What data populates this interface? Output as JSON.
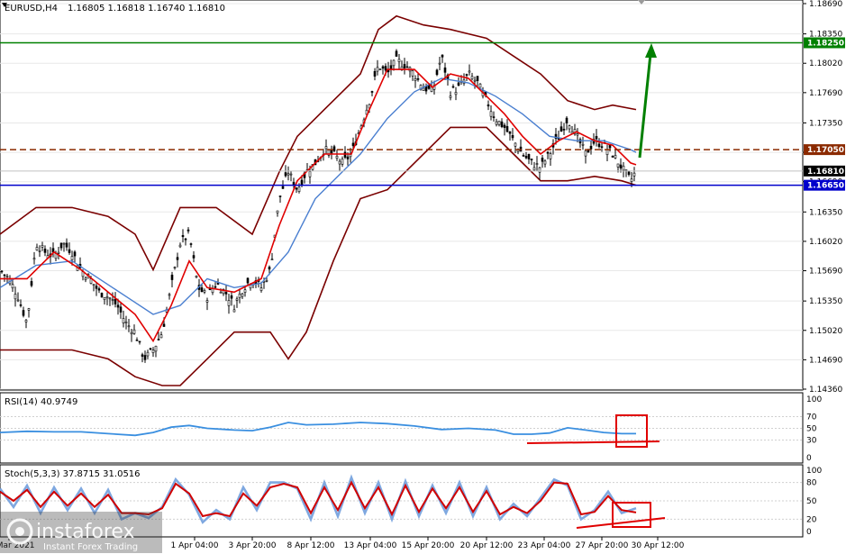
{
  "main_header": {
    "symbol": "EURUSD,H4",
    "values": "1.16805 1.16818 1.16740 1.16810"
  },
  "rsi_header": {
    "label": "RSI(14) 40.9749"
  },
  "stoch_header": {
    "label": "Stoch(5,3,3) 37.8715 31.0516"
  },
  "price_axis": {
    "ticks": [
      "1.18690",
      "1.18350",
      "1.18020",
      "1.17690",
      "1.17350",
      "1.17020",
      "1.16690",
      "1.16350",
      "1.16020",
      "1.15690",
      "1.15350",
      "1.15020",
      "1.14690",
      "1.14360"
    ],
    "levels": [
      {
        "name": "resistance",
        "value": 1.1825,
        "label": "1.18250",
        "color": "#008000",
        "style": "solid"
      },
      {
        "name": "pivot",
        "value": 1.1705,
        "label": "1.17050",
        "color": "#8b2a00",
        "style": "dashed"
      },
      {
        "name": "current",
        "value": 1.1681,
        "label": "1.16810",
        "color": "#c0c0c0",
        "style": "solid"
      },
      {
        "name": "support",
        "value": 1.1665,
        "label": "1.16650",
        "color": "#0000cc",
        "style": "solid"
      }
    ]
  },
  "rsi_axis": {
    "ticks": [
      "100",
      "70",
      "50",
      "30",
      "0"
    ]
  },
  "stoch_axis": {
    "ticks": [
      "100",
      "80",
      "50",
      "20",
      "0"
    ]
  },
  "time_axis": {
    "labels": [
      "29 Mar 2021",
      "1 Apr 04:00",
      "3 Apr 20:00",
      "8 Apr 12:00",
      "13 Apr 04:00",
      "15 Apr 20:00",
      "20 Apr 12:00",
      "23 Apr 04:00",
      "27 Apr 20:00",
      "30 Apr 12:00"
    ]
  },
  "annotations": {
    "arrow_color": "#008000",
    "divergence_color": "#e00000",
    "box_color": "#e00000"
  },
  "watermark": {
    "brand": "instaforex",
    "tagline": "Instant Forex Trading"
  },
  "chart_data": {
    "type": "candlestick",
    "symbol": "EURUSD",
    "timeframe": "H4",
    "ylim": [
      1.1436,
      1.1869
    ],
    "indicators": [
      "Bollinger Bands",
      "Moving Averages",
      "RSI(14)",
      "Stoch(5,3,3)"
    ],
    "close_path": [
      [
        0,
        1.157
      ],
      [
        10,
        1.156
      ],
      [
        20,
        1.154
      ],
      [
        30,
        1.151
      ],
      [
        40,
        1.16
      ],
      [
        50,
        1.159
      ],
      [
        60,
        1.1585
      ],
      [
        70,
        1.16
      ],
      [
        80,
        1.159
      ],
      [
        90,
        1.157
      ],
      [
        100,
        1.156
      ],
      [
        110,
        1.1545
      ],
      [
        120,
        1.154
      ],
      [
        130,
        1.153
      ],
      [
        140,
        1.151
      ],
      [
        150,
        1.15
      ],
      [
        160,
        1.147
      ],
      [
        170,
        1.148
      ],
      [
        180,
        1.15
      ],
      [
        190,
        1.155
      ],
      [
        200,
        1.16
      ],
      [
        210,
        1.161
      ],
      [
        220,
        1.155
      ],
      [
        230,
        1.154
      ],
      [
        240,
        1.1555
      ],
      [
        250,
        1.1545
      ],
      [
        260,
        1.153
      ],
      [
        270,
        1.155
      ],
      [
        280,
        1.156
      ],
      [
        290,
        1.155
      ],
      [
        300,
        1.157
      ],
      [
        310,
        1.165
      ],
      [
        320,
        1.168
      ],
      [
        330,
        1.166
      ],
      [
        340,
        1.168
      ],
      [
        350,
        1.169
      ],
      [
        360,
        1.1705
      ],
      [
        370,
        1.17
      ],
      [
        380,
        1.169
      ],
      [
        390,
        1.17
      ],
      [
        400,
        1.173
      ],
      [
        410,
        1.176
      ],
      [
        420,
        1.18
      ],
      [
        430,
        1.179
      ],
      [
        440,
        1.1805
      ],
      [
        450,
        1.18
      ],
      [
        460,
        1.179
      ],
      [
        470,
        1.1775
      ],
      [
        480,
        1.177
      ],
      [
        490,
        1.181
      ],
      [
        500,
        1.177
      ],
      [
        510,
        1.1775
      ],
      [
        520,
        1.179
      ],
      [
        530,
        1.178
      ],
      [
        540,
        1.176
      ],
      [
        550,
        1.174
      ],
      [
        560,
        1.173
      ],
      [
        570,
        1.1715
      ],
      [
        580,
        1.17
      ],
      [
        590,
        1.169
      ],
      [
        600,
        1.1685
      ],
      [
        610,
        1.17
      ],
      [
        620,
        1.172
      ],
      [
        630,
        1.174
      ],
      [
        640,
        1.172
      ],
      [
        650,
        1.17
      ],
      [
        660,
        1.1715
      ],
      [
        670,
        1.171
      ],
      [
        680,
        1.17
      ],
      [
        690,
        1.1685
      ],
      [
        700,
        1.167
      ],
      [
        706,
        1.1681
      ]
    ],
    "upper_band": [
      [
        0,
        1.161
      ],
      [
        40,
        1.164
      ],
      [
        80,
        1.164
      ],
      [
        120,
        1.163
      ],
      [
        150,
        1.161
      ],
      [
        170,
        1.157
      ],
      [
        200,
        1.164
      ],
      [
        240,
        1.164
      ],
      [
        280,
        1.161
      ],
      [
        310,
        1.168
      ],
      [
        330,
        1.172
      ],
      [
        360,
        1.175
      ],
      [
        400,
        1.179
      ],
      [
        420,
        1.184
      ],
      [
        440,
        1.1855
      ],
      [
        470,
        1.1845
      ],
      [
        500,
        1.184
      ],
      [
        540,
        1.183
      ],
      [
        570,
        1.181
      ],
      [
        600,
        1.179
      ],
      [
        630,
        1.176
      ],
      [
        660,
        1.175
      ],
      [
        680,
        1.1755
      ],
      [
        706,
        1.175
      ]
    ],
    "lower_band": [
      [
        0,
        1.148
      ],
      [
        40,
        1.148
      ],
      [
        80,
        1.148
      ],
      [
        120,
        1.147
      ],
      [
        150,
        1.145
      ],
      [
        180,
        1.144
      ],
      [
        200,
        1.144
      ],
      [
        230,
        1.147
      ],
      [
        260,
        1.15
      ],
      [
        300,
        1.15
      ],
      [
        320,
        1.147
      ],
      [
        340,
        1.15
      ],
      [
        370,
        1.158
      ],
      [
        400,
        1.165
      ],
      [
        430,
        1.166
      ],
      [
        460,
        1.169
      ],
      [
        500,
        1.173
      ],
      [
        540,
        1.173
      ],
      [
        570,
        1.17
      ],
      [
        600,
        1.167
      ],
      [
        630,
        1.167
      ],
      [
        660,
        1.1675
      ],
      [
        690,
        1.167
      ],
      [
        706,
        1.1665
      ]
    ],
    "ma_fast": [
      [
        0,
        1.156
      ],
      [
        30,
        1.156
      ],
      [
        60,
        1.159
      ],
      [
        90,
        1.157
      ],
      [
        120,
        1.1545
      ],
      [
        150,
        1.152
      ],
      [
        170,
        1.149
      ],
      [
        190,
        1.153
      ],
      [
        210,
        1.158
      ],
      [
        230,
        1.155
      ],
      [
        260,
        1.1545
      ],
      [
        290,
        1.156
      ],
      [
        310,
        1.162
      ],
      [
        330,
        1.167
      ],
      [
        360,
        1.17
      ],
      [
        390,
        1.17
      ],
      [
        410,
        1.175
      ],
      [
        430,
        1.1795
      ],
      [
        460,
        1.1795
      ],
      [
        480,
        1.1775
      ],
      [
        500,
        1.179
      ],
      [
        520,
        1.1785
      ],
      [
        540,
        1.1765
      ],
      [
        560,
        1.1745
      ],
      [
        580,
        1.172
      ],
      [
        600,
        1.17
      ],
      [
        620,
        1.1715
      ],
      [
        640,
        1.1725
      ],
      [
        660,
        1.1715
      ],
      [
        680,
        1.171
      ],
      [
        700,
        1.169
      ],
      [
        706,
        1.1688
      ]
    ],
    "ma_slow": [
      [
        0,
        1.155
      ],
      [
        40,
        1.1575
      ],
      [
        80,
        1.158
      ],
      [
        110,
        1.156
      ],
      [
        140,
        1.154
      ],
      [
        170,
        1.152
      ],
      [
        200,
        1.153
      ],
      [
        230,
        1.156
      ],
      [
        260,
        1.155
      ],
      [
        290,
        1.1555
      ],
      [
        320,
        1.159
      ],
      [
        350,
        1.165
      ],
      [
        380,
        1.168
      ],
      [
        400,
        1.17
      ],
      [
        430,
        1.174
      ],
      [
        460,
        1.177
      ],
      [
        490,
        1.1785
      ],
      [
        520,
        1.178
      ],
      [
        550,
        1.1765
      ],
      [
        580,
        1.1745
      ],
      [
        610,
        1.172
      ],
      [
        640,
        1.1715
      ],
      [
        670,
        1.1715
      ],
      [
        700,
        1.1705
      ],
      [
        706,
        1.1702
      ]
    ],
    "rsi": [
      [
        0,
        43
      ],
      [
        30,
        45
      ],
      [
        60,
        44
      ],
      [
        90,
        44
      ],
      [
        120,
        41
      ],
      [
        150,
        38
      ],
      [
        170,
        43
      ],
      [
        190,
        52
      ],
      [
        210,
        55
      ],
      [
        230,
        50
      ],
      [
        260,
        47
      ],
      [
        280,
        46
      ],
      [
        300,
        52
      ],
      [
        320,
        60
      ],
      [
        340,
        56
      ],
      [
        370,
        57
      ],
      [
        400,
        60
      ],
      [
        430,
        58
      ],
      [
        460,
        54
      ],
      [
        490,
        48
      ],
      [
        520,
        50
      ],
      [
        550,
        47
      ],
      [
        570,
        40
      ],
      [
        590,
        40
      ],
      [
        610,
        42
      ],
      [
        630,
        51
      ],
      [
        650,
        47
      ],
      [
        670,
        43
      ],
      [
        690,
        41
      ],
      [
        706,
        41
      ]
    ],
    "stoch_k": [
      [
        0,
        70
      ],
      [
        15,
        40
      ],
      [
        30,
        75
      ],
      [
        45,
        30
      ],
      [
        60,
        72
      ],
      [
        75,
        35
      ],
      [
        90,
        70
      ],
      [
        105,
        30
      ],
      [
        120,
        68
      ],
      [
        135,
        20
      ],
      [
        150,
        30
      ],
      [
        165,
        22
      ],
      [
        180,
        40
      ],
      [
        195,
        85
      ],
      [
        210,
        60
      ],
      [
        225,
        15
      ],
      [
        240,
        35
      ],
      [
        255,
        20
      ],
      [
        270,
        72
      ],
      [
        285,
        35
      ],
      [
        300,
        80
      ],
      [
        315,
        80
      ],
      [
        330,
        70
      ],
      [
        345,
        20
      ],
      [
        360,
        80
      ],
      [
        375,
        25
      ],
      [
        390,
        88
      ],
      [
        405,
        30
      ],
      [
        420,
        80
      ],
      [
        435,
        20
      ],
      [
        450,
        82
      ],
      [
        465,
        25
      ],
      [
        480,
        75
      ],
      [
        495,
        30
      ],
      [
        510,
        80
      ],
      [
        525,
        25
      ],
      [
        540,
        72
      ],
      [
        555,
        20
      ],
      [
        570,
        45
      ],
      [
        585,
        25
      ],
      [
        600,
        55
      ],
      [
        615,
        85
      ],
      [
        630,
        75
      ],
      [
        645,
        20
      ],
      [
        660,
        35
      ],
      [
        675,
        65
      ],
      [
        690,
        30
      ],
      [
        706,
        38
      ]
    ],
    "stoch_d": [
      [
        0,
        65
      ],
      [
        15,
        50
      ],
      [
        30,
        68
      ],
      [
        45,
        40
      ],
      [
        60,
        65
      ],
      [
        75,
        42
      ],
      [
        90,
        62
      ],
      [
        105,
        40
      ],
      [
        120,
        60
      ],
      [
        135,
        30
      ],
      [
        150,
        30
      ],
      [
        165,
        28
      ],
      [
        180,
        38
      ],
      [
        195,
        78
      ],
      [
        210,
        62
      ],
      [
        225,
        25
      ],
      [
        240,
        30
      ],
      [
        255,
        25
      ],
      [
        270,
        62
      ],
      [
        285,
        42
      ],
      [
        300,
        72
      ],
      [
        315,
        78
      ],
      [
        330,
        72
      ],
      [
        345,
        30
      ],
      [
        360,
        72
      ],
      [
        375,
        35
      ],
      [
        390,
        80
      ],
      [
        405,
        38
      ],
      [
        420,
        72
      ],
      [
        435,
        28
      ],
      [
        450,
        75
      ],
      [
        465,
        32
      ],
      [
        480,
        70
      ],
      [
        495,
        38
      ],
      [
        510,
        72
      ],
      [
        525,
        32
      ],
      [
        540,
        66
      ],
      [
        555,
        28
      ],
      [
        570,
        40
      ],
      [
        585,
        30
      ],
      [
        600,
        50
      ],
      [
        615,
        80
      ],
      [
        630,
        78
      ],
      [
        645,
        28
      ],
      [
        660,
        32
      ],
      [
        675,
        58
      ],
      [
        690,
        35
      ],
      [
        706,
        31
      ]
    ]
  }
}
